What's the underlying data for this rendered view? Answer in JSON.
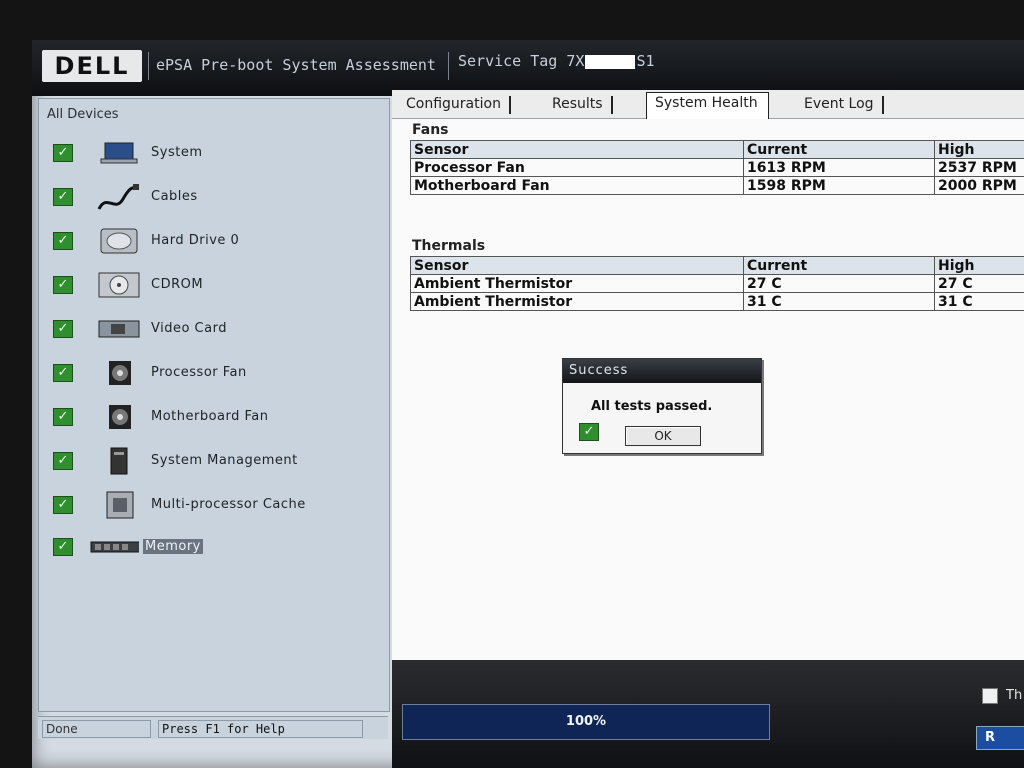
{
  "header": {
    "logo_text": "DELL",
    "app_title": "ePSA Pre-boot System Assessment",
    "service_tag_prefix": "Service Tag 7X",
    "service_tag_suffix": "S1"
  },
  "left_panel": {
    "title": "All Devices",
    "devices": [
      {
        "label": "System",
        "icon": "laptop-icon",
        "checked": true
      },
      {
        "label": "Cables",
        "icon": "cable-icon",
        "checked": true
      },
      {
        "label": "Hard Drive 0",
        "icon": "hard-drive-icon",
        "checked": true
      },
      {
        "label": "CDROM",
        "icon": "cdrom-icon",
        "checked": true
      },
      {
        "label": "Video Card",
        "icon": "video-card-icon",
        "checked": true
      },
      {
        "label": "Processor Fan",
        "icon": "fan-icon",
        "checked": true
      },
      {
        "label": "Motherboard Fan",
        "icon": "fan-icon",
        "checked": true
      },
      {
        "label": "System Management",
        "icon": "tower-icon",
        "checked": true
      },
      {
        "label": "Multi-processor Cache",
        "icon": "cpu-icon",
        "checked": true
      },
      {
        "label": "Memory",
        "icon": "memory-icon",
        "checked": true
      }
    ]
  },
  "tabs": [
    {
      "label": "Configuration"
    },
    {
      "label": "Results"
    },
    {
      "label": "System Health"
    },
    {
      "label": "Event Log"
    }
  ],
  "fans": {
    "title": "Fans",
    "headers": [
      "Sensor",
      "Current",
      "High"
    ],
    "rows": [
      [
        "Processor Fan",
        "1613 RPM",
        "2537 RPM"
      ],
      [
        "Motherboard Fan",
        "1598 RPM",
        "2000 RPM"
      ]
    ]
  },
  "thermals": {
    "title": "Thermals",
    "headers": [
      "Sensor",
      "Current",
      "High"
    ],
    "rows": [
      [
        "Ambient Thermistor",
        "27 C",
        "27 C"
      ],
      [
        "Ambient Thermistor",
        "31 C",
        "31 C"
      ]
    ]
  },
  "dialog": {
    "title": "Success",
    "message": "All tests passed.",
    "ok_label": "OK"
  },
  "progress": {
    "value_percent": 100,
    "label": "100%"
  },
  "options": {
    "label": "Th"
  },
  "run_button": {
    "label": "R"
  },
  "status": {
    "state": "Done",
    "help": "Press F1 for Help"
  },
  "colors": {
    "check_green": "#2f8f2f",
    "progress_blue": "#0f2556",
    "header_dark": "#0d0f12"
  }
}
